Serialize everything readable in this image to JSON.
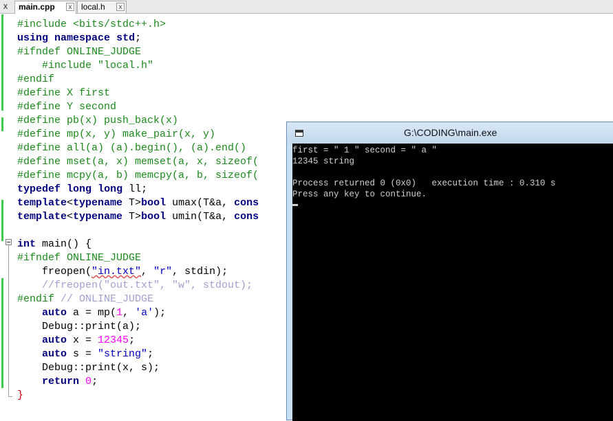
{
  "tabs": [
    {
      "label": "main.cpp",
      "close": "x"
    },
    {
      "label": "local.h",
      "close": "x"
    }
  ],
  "tabbar_close": "x",
  "editor": {
    "lines": {
      "l1": {
        "a": "#include <bits/stdc++.h>"
      },
      "l2": {
        "a": "using",
        "b": " ",
        "c": "namespace",
        "d": " ",
        "e": "std",
        "f": ";"
      },
      "l3": {
        "a": "#ifndef ONLINE_JUDGE"
      },
      "l4": {
        "a": "    #include \"local.h\""
      },
      "l5": {
        "a": "#endif"
      },
      "l6": {
        "a": "#define X first"
      },
      "l7": {
        "a": "#define Y second"
      },
      "l8": {
        "a": "#define pb(x) push_back(x)"
      },
      "l9": {
        "a": "#define mp(x, y) make_pair(x, y)"
      },
      "l10": {
        "a": "#define all(a) (a).begin(), (a).end()"
      },
      "l11": {
        "a": "#define mset(a, x) memset(a, x, sizeof("
      },
      "l12": {
        "a": "#define mcpy(a, b) memcpy(a, b, sizeof("
      },
      "l13": {
        "a": "typedef",
        "b": " ",
        "c": "long",
        "d": " ",
        "e": "long",
        "f": " ll;"
      },
      "l14": {
        "a": "template",
        "b": "<",
        "c": "typename",
        "d": " T>",
        "e": "bool",
        "f": " umax(T&a, ",
        "g": "cons"
      },
      "l15": {
        "a": "template",
        "b": "<",
        "c": "typename",
        "d": " T>",
        "e": "bool",
        "f": " umin(T&a, ",
        "g": "cons"
      },
      "l16": {
        "a": ""
      },
      "l17": {
        "a": "int",
        "b": " main() {"
      },
      "l18": {
        "a": "#ifndef ONLINE_JUDGE"
      },
      "l19": {
        "a": "    freopen(",
        "b": "\"in.txt\"",
        "c": ", ",
        "d": "\"r\"",
        "e": ", stdin);"
      },
      "l20": {
        "a": "    //freopen(\"out.txt\", \"w\", stdout);"
      },
      "l21": {
        "a": "#endif",
        "b": " // ONLINE_JUDGE"
      },
      "l22": {
        "a": "    ",
        "b": "auto",
        "c": " a = mp(",
        "d": "1",
        "e": ", ",
        "f": "'a'",
        "g": ");"
      },
      "l23": {
        "a": "    Debug::print(a);"
      },
      "l24": {
        "a": "    ",
        "b": "auto",
        "c": " x = ",
        "d": "12345",
        "e": ";"
      },
      "l25": {
        "a": "    ",
        "b": "auto",
        "c": " s = ",
        "d": "\"string\"",
        "e": ";"
      },
      "l26": {
        "a": "    Debug::print(x, s);"
      },
      "l27": {
        "a": "    ",
        "b": "return",
        "c": " ",
        "d": "0",
        "e": ";"
      },
      "l28": {
        "a": "}"
      }
    }
  },
  "console": {
    "title": "G:\\CODING\\main.exe",
    "lines": [
      "first = \" 1 \" second = \" a \"",
      "12345 string",
      "",
      "Process returned 0 (0x0)   execution time : 0.310 s",
      "Press any key to continue."
    ]
  },
  "colors": {
    "change_bar": "#3ecb4f",
    "preprocessor": "#1a8a1a",
    "keyword": "#000080",
    "string": "#0000c0",
    "number": "#ff00ff",
    "comment": "#a0a0d0",
    "console_bg": "#000000",
    "console_text": "#d0d0d0"
  }
}
